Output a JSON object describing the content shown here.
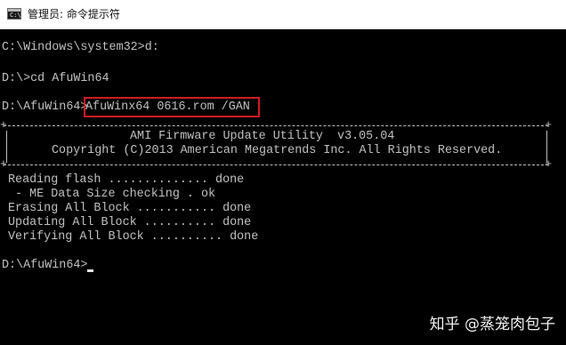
{
  "window": {
    "title": "管理员: 命令提示符",
    "icon": "cmd-icon"
  },
  "console": {
    "lines": [
      "C:\\Windows\\system32>d:",
      "",
      "D:\\>cd AfuWin64",
      "",
      "D:\\AfuWin64>",
      "AfuWinx64 0616.rom /GAN",
      "AMI Firmware Update Utility  v3.05.04",
      "Copyright (C)2013 American Megatrends Inc. All Rights Reserved.",
      "Reading flash .............. done",
      " - ME Data Size checking . ok",
      "Erasing All Block ........... done",
      "Updating All Block .......... done",
      "Verifying All Block .......... done",
      "D:\\AfuWin64>"
    ],
    "highlight_color": "#d11a24"
  },
  "watermark": {
    "text": "知乎 @蒸笼肉包子"
  }
}
